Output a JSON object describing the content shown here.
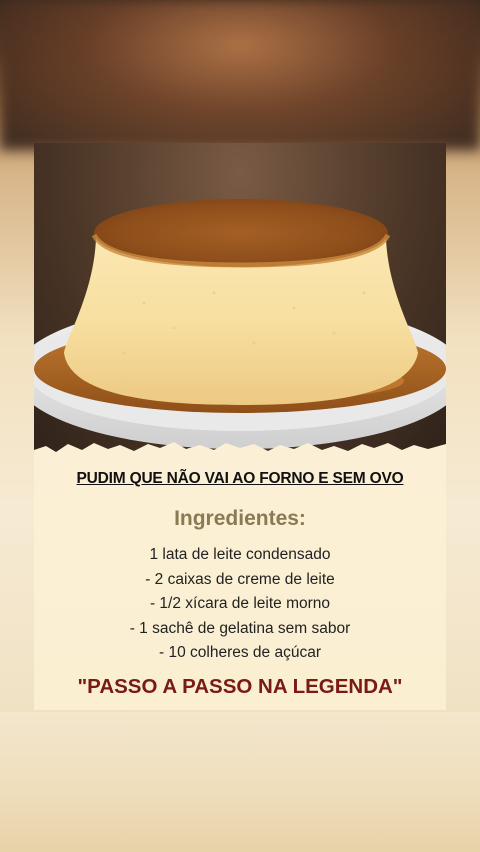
{
  "post": {
    "title": "PUDIM QUE NÃO VAI AO FORNO E SEM OVO",
    "ingredients_heading": "Ingredientes:",
    "ingredients": [
      "1 lata de leite condensado",
      "- 2 caixas de creme de leite",
      "- 1/2 xícara de leite morno",
      "- 1 sachê de gelatina sem sabor",
      "- 10 colheres de açúcar"
    ],
    "cta": "\"PASSO A PASSO NA LEGENDA\""
  },
  "colors": {
    "title": "#111111",
    "heading": "#8a7a54",
    "cta": "#7a1a14",
    "card": "#fbf1d9",
    "caramel": "#b9712c",
    "custard": "#f5dc9a"
  },
  "image": {
    "subject": "pudim-with-caramel-on-white-plate"
  }
}
